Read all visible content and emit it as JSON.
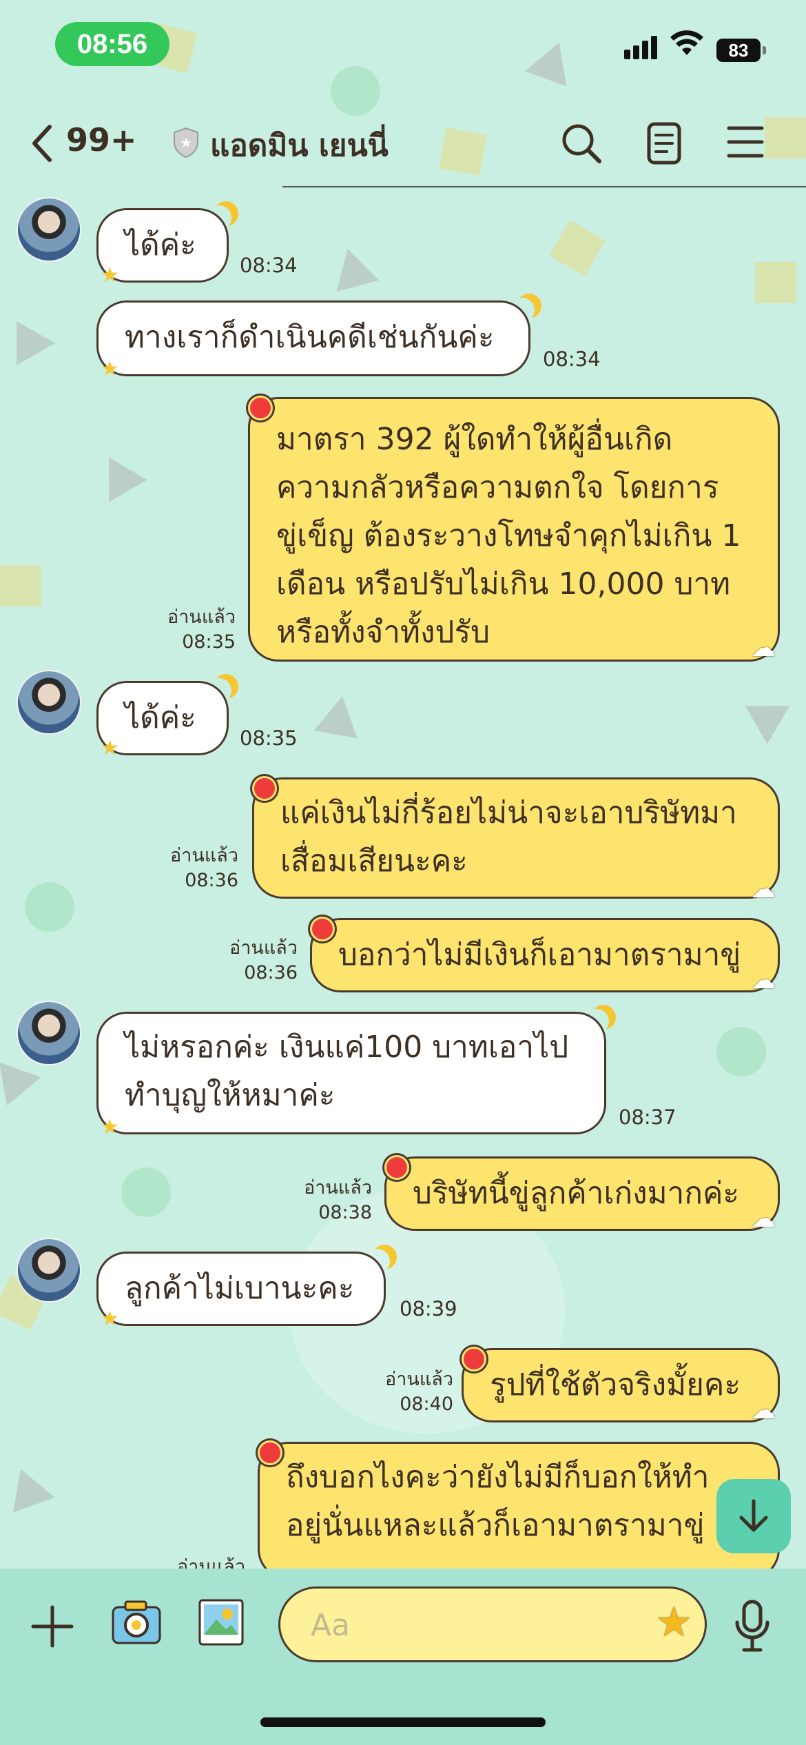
{
  "status_bar": {
    "time": "08:56",
    "battery": "83"
  },
  "header": {
    "unread": "99+",
    "title": "แอดมิน เยนนี่"
  },
  "messages": [
    {
      "text": "ได้ค่ะ",
      "time": "08:34"
    },
    {
      "text": "ทางเราก็ดำเนินคดีเช่นกันค่ะ",
      "time": "08:34"
    },
    {
      "lines": [
        "มาตรา 392 ผู้ใดทำให้ผู้อื่นเกิด",
        "ความกลัวหรือความตกใจ โดยการ",
        "ขู่เข็ญ ต้องระวางโทษจำคุกไม่เกิน 1",
        "เดือน หรือปรับไม่เกิน 10,000 บาท",
        "หรือทั้งจำทั้งปรับ"
      ],
      "read": "อ่านแล้ว",
      "time": "08:35"
    },
    {
      "text": "ได้ค่ะ",
      "time": "08:35"
    },
    {
      "lines": [
        "แค่เงินไม่กี่ร้อยไม่น่าจะเอาบริษัทมา",
        "เสื่อมเสียนะคะ"
      ],
      "read": "อ่านแล้ว",
      "time": "08:36"
    },
    {
      "text": "บอกว่าไม่มีเงินก็เอามาตรามาขู่",
      "read": "อ่านแล้ว",
      "time": "08:36"
    },
    {
      "lines": [
        "ไม่หรอกค่ะ เงินแค่100 บาทเอาไป",
        "ทำบุญให้หมาค่ะ"
      ],
      "time": "08:37"
    },
    {
      "text": "บริษัทนี้ขู่ลูกค้าเก่งมากค่ะ",
      "read": "อ่านแล้ว",
      "time": "08:38"
    },
    {
      "text": "ลูกค้าไม่เบานะคะ",
      "time": "08:39"
    },
    {
      "text": "รูปที่ใช้ตัวจริงมั้ยคะ",
      "read": "อ่านแล้ว",
      "time": "08:40"
    },
    {
      "lines": [
        "ถึงบอกไงคะว่ายังไม่มีก็บอกให้ทำ",
        "อยู่นั่นแหละแล้วก็เอามาตรามาขู่"
      ],
      "read": "อ่านแล้ว"
    }
  ],
  "composer": {
    "placeholder": "Aa"
  },
  "icons": {
    "back": "chevron-left-icon",
    "shield": "shield-icon",
    "search": "search-icon",
    "notes": "note-icon",
    "menu": "menu-icon",
    "plus": "plus-icon",
    "camera": "camera-icon",
    "image": "image-icon",
    "mic": "mic-icon",
    "scroll": "arrow-down-icon",
    "sticker": "star-icon"
  },
  "colors": {
    "background": "#c9efe3",
    "outgoing_bubble": "#fde46e",
    "incoming_bubble": "#ffffff",
    "time_pill": "#34c759",
    "scroll_button": "#5bcfae",
    "input_bar": "#a6e3d0"
  }
}
